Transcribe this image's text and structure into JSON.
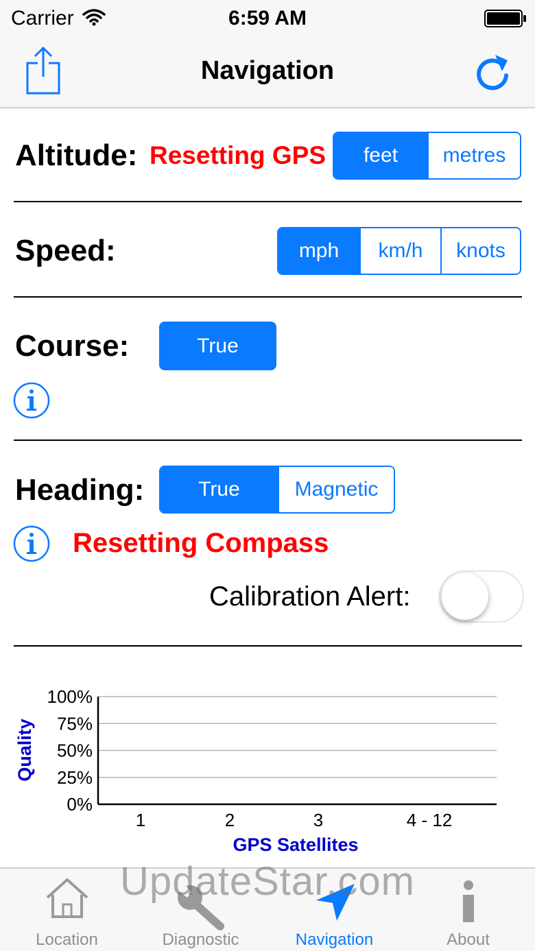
{
  "status_bar": {
    "carrier": "Carrier",
    "time": "6:59 AM"
  },
  "nav_bar": {
    "title": "Navigation"
  },
  "altitude": {
    "label": "Altitude:",
    "status": "Resetting GPS",
    "units": [
      {
        "label": "feet",
        "selected": true
      },
      {
        "label": "metres",
        "selected": false
      }
    ]
  },
  "speed": {
    "label": "Speed:",
    "units": [
      {
        "label": "mph",
        "selected": true
      },
      {
        "label": "km/h",
        "selected": false
      },
      {
        "label": "knots",
        "selected": false
      }
    ]
  },
  "course": {
    "label": "Course:",
    "mode": "True"
  },
  "heading": {
    "label": "Heading:",
    "modes": [
      {
        "label": "True",
        "selected": true
      },
      {
        "label": "Magnetic",
        "selected": false
      }
    ],
    "status": "Resetting Compass",
    "calibration_label": "Calibration Alert:",
    "calibration_alert_on": false
  },
  "chart_data": {
    "type": "bar",
    "categories": [
      "1",
      "2",
      "3",
      "4 - 12"
    ],
    "values": [
      0,
      0,
      0,
      0
    ],
    "ylabel": "Quality",
    "xlabel": "GPS Satellites",
    "yticks": [
      "0%",
      "25%",
      "50%",
      "75%",
      "100%"
    ],
    "ylim": [
      0,
      100
    ],
    "grid": true,
    "colors": {
      "axis_labels": "#0000cc"
    }
  },
  "tab_bar": {
    "tabs": [
      {
        "label": "Location",
        "icon": "house-icon",
        "active": false
      },
      {
        "label": "Diagnostic",
        "icon": "wrench-icon",
        "active": false
      },
      {
        "label": "Navigation",
        "icon": "navigation-arrow-icon",
        "active": true
      },
      {
        "label": "About",
        "icon": "info-icon",
        "active": false
      }
    ]
  },
  "watermark": "UpdateStar.com",
  "colors": {
    "accent": "#0a7aff",
    "alert": "#ff0000"
  }
}
